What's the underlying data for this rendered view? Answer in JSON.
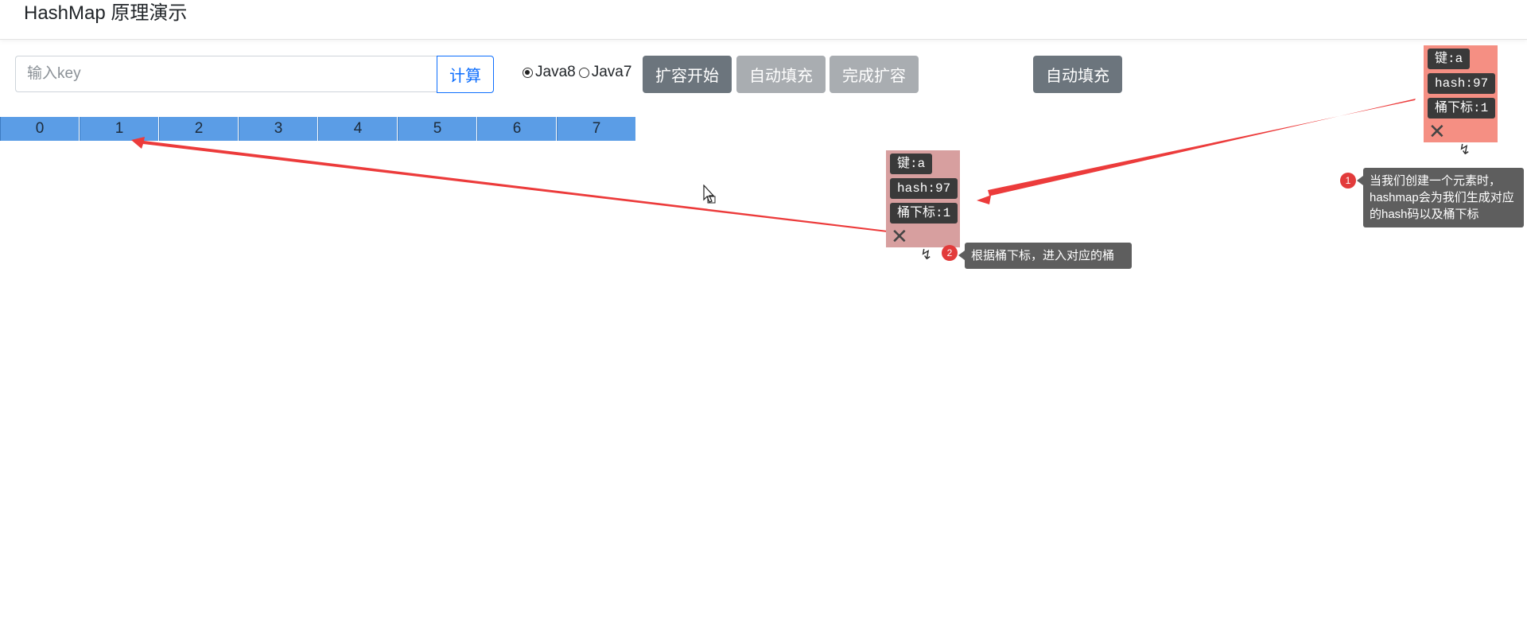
{
  "header": {
    "title": "HashMap 原理演示"
  },
  "controls": {
    "key_input_placeholder": "输入key",
    "calc_label": "计算",
    "versions": [
      {
        "label": "Java8",
        "checked": true
      },
      {
        "label": "Java7",
        "checked": false
      }
    ],
    "expand_start_label": "扩容开始",
    "auto_fill_label": "自动填充",
    "finish_expand_label": "完成扩容",
    "auto_fill_label_2": "自动填充"
  },
  "buckets": [
    "0",
    "1",
    "2",
    "3",
    "4",
    "5",
    "6",
    "7"
  ],
  "node_new": {
    "key": "键:a",
    "hash": "hash:97",
    "index": "桶下标:1",
    "color": "#f58f83"
  },
  "node_moving": {
    "key": "键:a",
    "hash": "hash:97",
    "index": "桶下标:1",
    "color": "#d79f9f"
  },
  "tips": [
    {
      "num": "1",
      "text": "当我们创建一个元素时，hashmap会为我们生成对应的hash码以及桶下标"
    },
    {
      "num": "2",
      "text": "根据桶下标，进入对应的桶"
    }
  ],
  "colors": {
    "accent": "#0d6efd",
    "bucket": "#5b9de6",
    "arrow": "#ec3b3b",
    "tip_badge": "#e23b3b"
  }
}
